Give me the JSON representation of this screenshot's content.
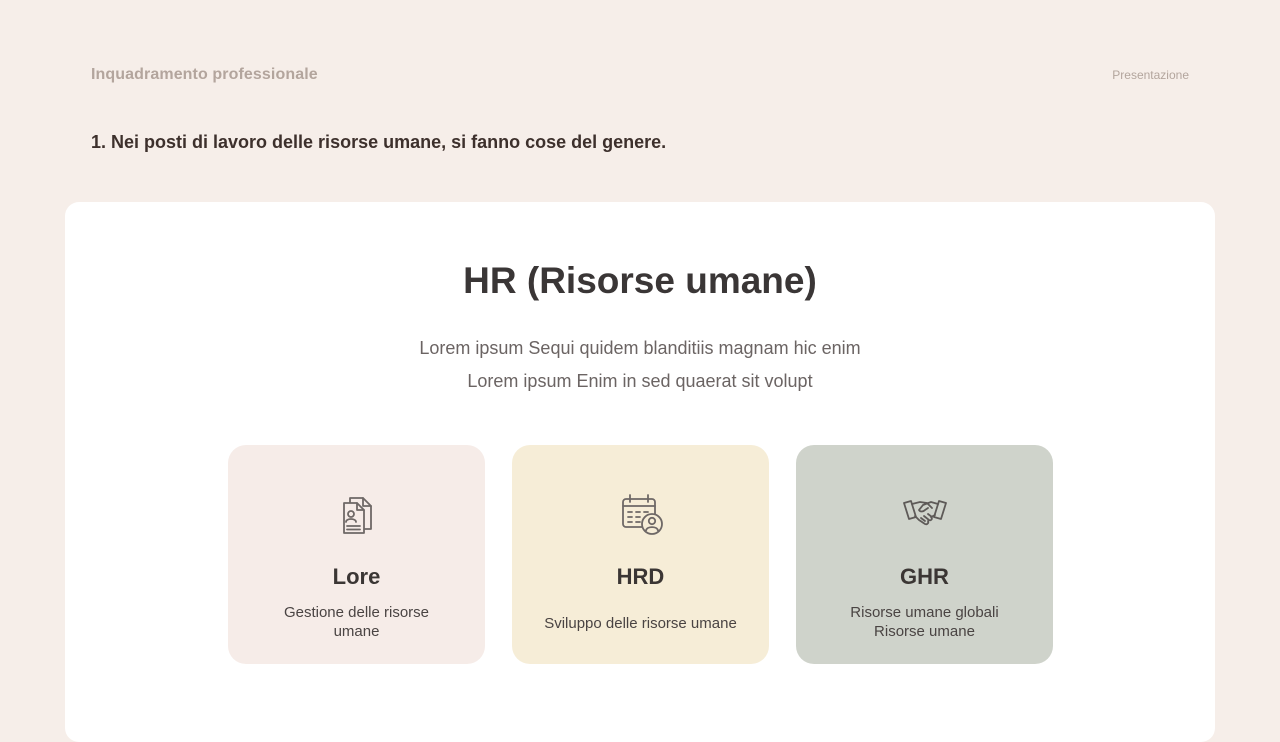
{
  "header": {
    "section_title": "Inquadramento professionale",
    "presentation_label": "Presentazione"
  },
  "question": "1. Nei posti di lavoro delle risorse umane, si fanno cose del genere.",
  "main": {
    "title": "HR (Risorse umane)",
    "subtitle_line1": "Lorem ipsum Sequi quidem blanditiis magnam hic enim",
    "subtitle_line2": "Lorem ipsum Enim in sed quaerat sit volupt",
    "cards": [
      {
        "title": "Lore",
        "description": "Gestione delle risorse\numane",
        "icon": "document-user-icon",
        "background": "#f6ece8"
      },
      {
        "title": "HRD",
        "description": "Sviluppo delle risorse umane",
        "icon": "calendar-user-icon",
        "background": "#f6edd7"
      },
      {
        "title": "GHR",
        "description": "Risorse umane globali\nRisorse umane",
        "icon": "handshake-icon",
        "background": "#cfd3cb"
      }
    ]
  },
  "colors": {
    "page_background": "#f6eee9",
    "card_background": "#ffffff",
    "muted_text": "#b3a59d",
    "heading_text": "#3a3636"
  }
}
